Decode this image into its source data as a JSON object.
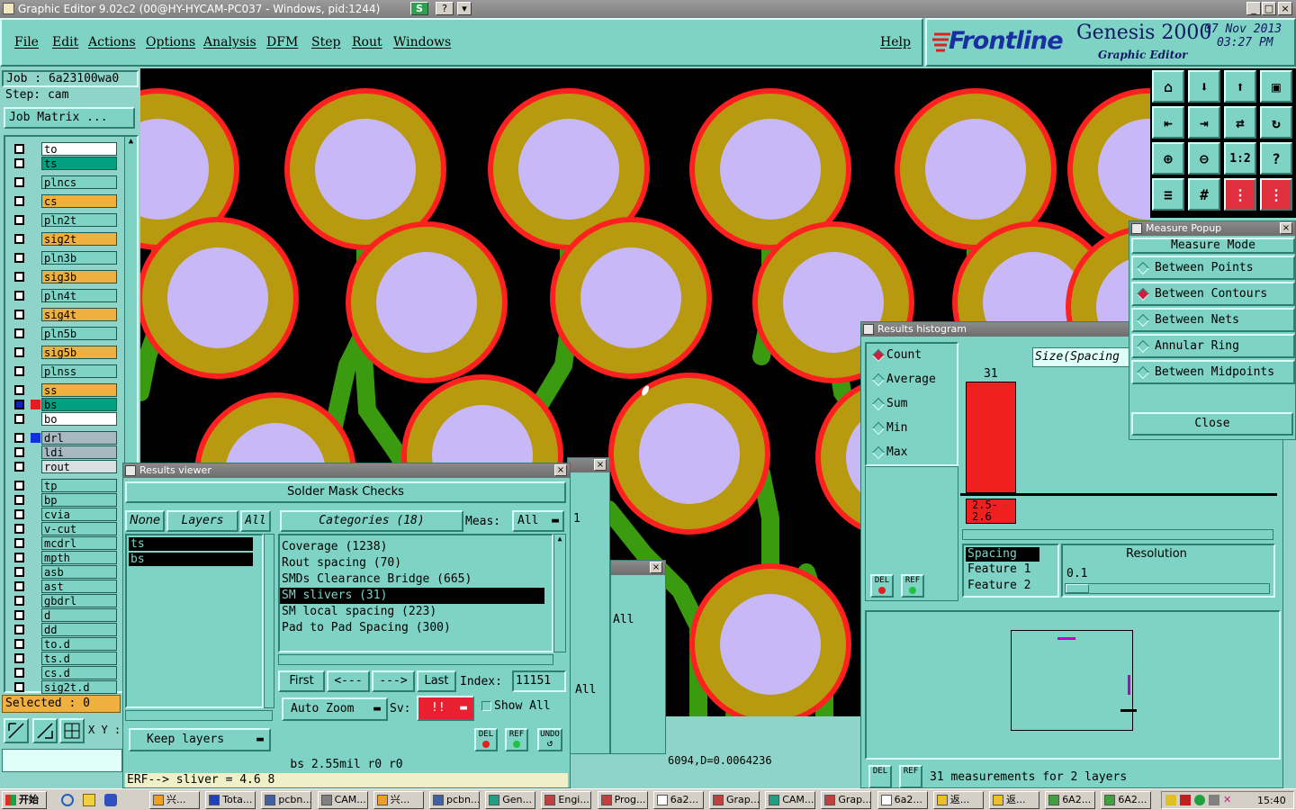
{
  "window": {
    "title": "Graphic Editor 9.02c2 (00@HY-HYCAM-PC037 - Windows, pid:1244)"
  },
  "menu": [
    "File",
    "Edit",
    "Actions",
    "Options",
    "Analysis",
    "DFM",
    "Step",
    "Rout",
    "Windows"
  ],
  "help_label": "Help",
  "brand": {
    "logo": "Frontline",
    "product": "Genesis 2000",
    "subtitle": "Graphic Editor",
    "date": "07 Nov 2013",
    "time": "03:27 PM"
  },
  "job": {
    "job_label": "Job : 6a23100wa0",
    "step_label": "Step: cam",
    "matrix_button": "Job Matrix ..."
  },
  "layers": [
    {
      "name": "to",
      "color": "#ffffff"
    },
    {
      "name": "ts",
      "color": "#00a080"
    },
    {
      "name": "plncs",
      "color": "#7ed3c4"
    },
    {
      "name": "cs",
      "color": "#f0b040"
    },
    {
      "name": "pln2t",
      "color": "#7ed3c4"
    },
    {
      "name": "sig2t",
      "color": "#f0b040"
    },
    {
      "name": "pln3b",
      "color": "#7ed3c4"
    },
    {
      "name": "sig3b",
      "color": "#f0b040"
    },
    {
      "name": "pln4t",
      "color": "#7ed3c4"
    },
    {
      "name": "sig4t",
      "color": "#f0b040"
    },
    {
      "name": "pln5b",
      "color": "#7ed3c4"
    },
    {
      "name": "sig5b",
      "color": "#f0b040"
    },
    {
      "name": "plnss",
      "color": "#7ed3c4"
    },
    {
      "name": "ss",
      "color": "#f0b040"
    },
    {
      "name": "bs",
      "color": "#00a080"
    },
    {
      "name": "bo",
      "color": "#ffffff"
    },
    {
      "name": "drl",
      "color": "#a8b8c0"
    },
    {
      "name": "ldi",
      "color": "#a8b8c0"
    },
    {
      "name": "rout",
      "color": "#d8e0e0"
    },
    {
      "name": "tp",
      "color": "#7ed3c4"
    },
    {
      "name": "bp",
      "color": "#7ed3c4"
    },
    {
      "name": "cvia",
      "color": "#7ed3c4"
    },
    {
      "name": "v-cut",
      "color": "#7ed3c4"
    },
    {
      "name": "mcdrl",
      "color": "#7ed3c4"
    },
    {
      "name": "mpth",
      "color": "#7ed3c4"
    },
    {
      "name": "asb",
      "color": "#7ed3c4"
    },
    {
      "name": "ast",
      "color": "#7ed3c4"
    },
    {
      "name": "gbdrl",
      "color": "#7ed3c4"
    },
    {
      "name": "d",
      "color": "#7ed3c4"
    },
    {
      "name": "dd",
      "color": "#7ed3c4"
    },
    {
      "name": "to.d",
      "color": "#7ed3c4"
    },
    {
      "name": "ts.d",
      "color": "#7ed3c4"
    },
    {
      "name": "cs.d",
      "color": "#7ed3c4"
    },
    {
      "name": "sig2t.d",
      "color": "#7ed3c4"
    }
  ],
  "selected_label": "Selected : 0",
  "xy_label": "X Y :",
  "results_viewer": {
    "title": "Results viewer",
    "header": "Solder Mask Checks",
    "none": "None",
    "layers": "Layers",
    "all": "All",
    "categories": "Categories (18)",
    "meas_label": "Meas:",
    "meas_value": "All",
    "layer_items": [
      "ts",
      "bs"
    ],
    "category_items": [
      "Coverage (1238)",
      "Rout spacing (70)",
      "SMDs Clearance Bridge (665)",
      "SM slivers (31)",
      "SM local spacing (223)",
      "Pad to Pad Spacing (300)"
    ],
    "selected_category": 3,
    "first": "First",
    "prev": "<---",
    "next": "--->",
    "last": "Last",
    "index_label": "Index:",
    "index_value": "11151",
    "auto_zoom": "Auto Zoom",
    "sv_label": "Sv:",
    "sv_value": "!!",
    "show_all": "Show All",
    "keep_layers": "Keep layers",
    "del": "DEL",
    "ref": "REF",
    "undo": "UNDO",
    "status": "bs 2.55mil  r0  r0",
    "err_line": "ERF--> sliver = 4.6 8"
  },
  "back_window": {
    "value_1": "1",
    "value_all": "All",
    "value_all2": "All",
    "coords": "6094,D=0.0064236"
  },
  "histogram": {
    "title": "Results histogram",
    "options": [
      "Count",
      "Average",
      "Sum",
      "Min",
      "Max"
    ],
    "selected": 0,
    "size_label": "Size(Spacing",
    "bar_count": "31",
    "bin_range": "2.5-2.6",
    "spacing_items": [
      "Spacing",
      "Feature 1",
      "Feature 2"
    ],
    "resolution_label": "Resolution",
    "resolution_value": "0.1",
    "summary": "31 measurements for 2 layers",
    "del": "DEL",
    "ref": "REF"
  },
  "measure_popup": {
    "title": "Measure Popup",
    "mode_label": "Measure Mode",
    "modes": [
      "Between Points",
      "Between Contours",
      "Between Nets",
      "Annular Ring",
      "Between Midpoints"
    ],
    "selected": 1,
    "close": "Close"
  },
  "taskbar": {
    "start": "开始",
    "tasks": [
      "兴...",
      "Tota...",
      "pcbn...",
      "CAM...",
      "兴...",
      "pcbn...",
      "Gen...",
      "Engi...",
      "Prog...",
      "6a2...",
      "Grap...",
      "CAM...",
      "Grap...",
      "6a2...",
      "返...",
      "返...",
      "6A2...",
      "6A2..."
    ],
    "clock": "15:40"
  }
}
